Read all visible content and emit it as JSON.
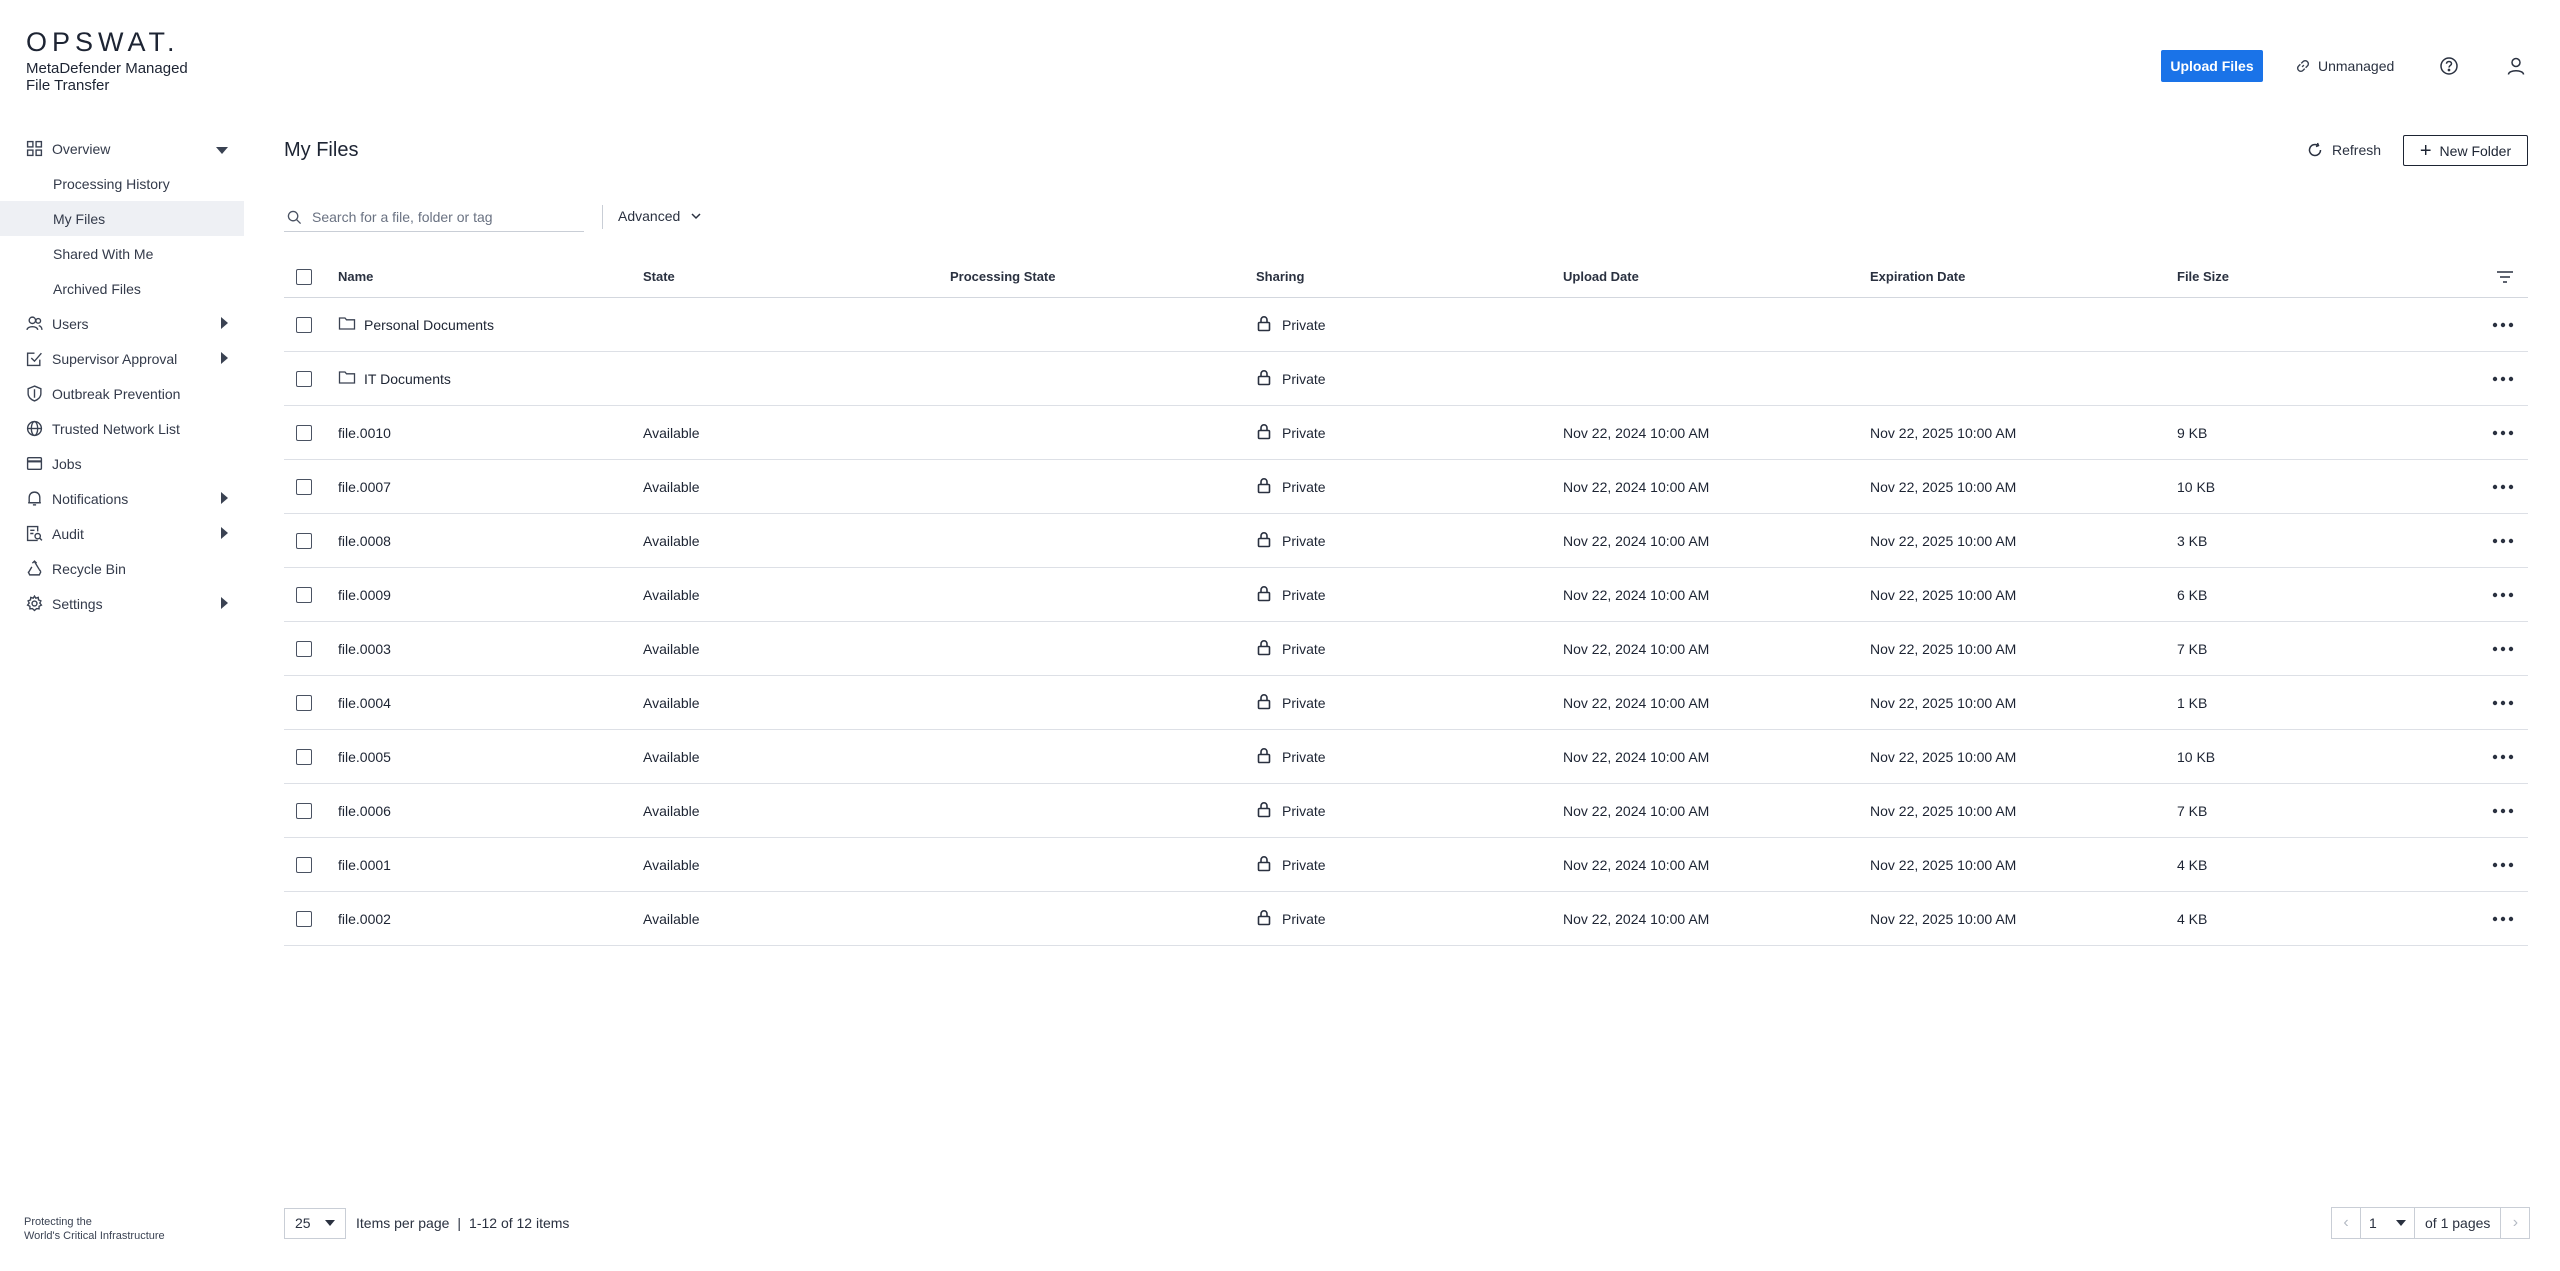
{
  "brand": {
    "logo": "OPSWAT.",
    "product": "MetaDefender Managed File Transfer",
    "footer_line1": "Protecting the",
    "footer_line2": "World's Critical Infrastructure"
  },
  "header": {
    "upload_label": "Upload Files",
    "unmanaged_label": "Unmanaged",
    "accent_color": "#1a73e8"
  },
  "sidebar": {
    "items": [
      {
        "label": "Overview",
        "icon": "grid-icon",
        "expanded": true
      },
      {
        "label": "Processing History"
      },
      {
        "label": "My Files",
        "active": true
      },
      {
        "label": "Shared With Me"
      },
      {
        "label": "Archived Files"
      },
      {
        "label": "Users",
        "icon": "users-icon"
      },
      {
        "label": "Supervisor Approval",
        "icon": "approval-icon"
      },
      {
        "label": "Outbreak Prevention",
        "icon": "shield-icon"
      },
      {
        "label": "Trusted Network List",
        "icon": "globe-icon"
      },
      {
        "label": "Jobs",
        "icon": "jobs-icon"
      },
      {
        "label": "Notifications",
        "icon": "bell-icon"
      },
      {
        "label": "Audit",
        "icon": "audit-icon"
      },
      {
        "label": "Recycle Bin",
        "icon": "recycle-icon"
      },
      {
        "label": "Settings",
        "icon": "gear-icon"
      }
    ]
  },
  "main": {
    "title": "My Files",
    "refresh_label": "Refresh",
    "new_folder_label": "New Folder",
    "search_placeholder": "Search for a file, folder or tag",
    "advanced_label": "Advanced"
  },
  "table": {
    "columns": [
      "Name",
      "State",
      "Processing State",
      "Sharing",
      "Upload Date",
      "Expiration Date",
      "File Size"
    ],
    "rows": [
      {
        "name": "Personal Documents",
        "type": "folder",
        "state": "",
        "processing": "",
        "sharing": "Private",
        "upload": "",
        "expiration": "",
        "size": ""
      },
      {
        "name": "IT Documents",
        "type": "folder",
        "state": "",
        "processing": "",
        "sharing": "Private",
        "upload": "",
        "expiration": "",
        "size": ""
      },
      {
        "name": "file.0010",
        "type": "file",
        "state": "Available",
        "processing": "",
        "sharing": "Private",
        "upload": "Nov 22, 2024 10:00 AM",
        "expiration": "Nov 22, 2025 10:00 AM",
        "size": "9 KB"
      },
      {
        "name": "file.0007",
        "type": "file",
        "state": "Available",
        "processing": "",
        "sharing": "Private",
        "upload": "Nov 22, 2024 10:00 AM",
        "expiration": "Nov 22, 2025 10:00 AM",
        "size": "10 KB"
      },
      {
        "name": "file.0008",
        "type": "file",
        "state": "Available",
        "processing": "",
        "sharing": "Private",
        "upload": "Nov 22, 2024 10:00 AM",
        "expiration": "Nov 22, 2025 10:00 AM",
        "size": "3 KB"
      },
      {
        "name": "file.0009",
        "type": "file",
        "state": "Available",
        "processing": "",
        "sharing": "Private",
        "upload": "Nov 22, 2024 10:00 AM",
        "expiration": "Nov 22, 2025 10:00 AM",
        "size": "6 KB"
      },
      {
        "name": "file.0003",
        "type": "file",
        "state": "Available",
        "processing": "",
        "sharing": "Private",
        "upload": "Nov 22, 2024 10:00 AM",
        "expiration": "Nov 22, 2025 10:00 AM",
        "size": "7 KB"
      },
      {
        "name": "file.0004",
        "type": "file",
        "state": "Available",
        "processing": "",
        "sharing": "Private",
        "upload": "Nov 22, 2024 10:00 AM",
        "expiration": "Nov 22, 2025 10:00 AM",
        "size": "1 KB"
      },
      {
        "name": "file.0005",
        "type": "file",
        "state": "Available",
        "processing": "",
        "sharing": "Private",
        "upload": "Nov 22, 2024 10:00 AM",
        "expiration": "Nov 22, 2025 10:00 AM",
        "size": "10 KB"
      },
      {
        "name": "file.0006",
        "type": "file",
        "state": "Available",
        "processing": "",
        "sharing": "Private",
        "upload": "Nov 22, 2024 10:00 AM",
        "expiration": "Nov 22, 2025 10:00 AM",
        "size": "7 KB"
      },
      {
        "name": "file.0001",
        "type": "file",
        "state": "Available",
        "processing": "",
        "sharing": "Private",
        "upload": "Nov 22, 2024 10:00 AM",
        "expiration": "Nov 22, 2025 10:00 AM",
        "size": "4 KB"
      },
      {
        "name": "file.0002",
        "type": "file",
        "state": "Available",
        "processing": "",
        "sharing": "Private",
        "upload": "Nov 22, 2024 10:00 AM",
        "expiration": "Nov 22, 2025 10:00 AM",
        "size": "4 KB"
      }
    ]
  },
  "pagination": {
    "per_page": "25",
    "per_page_label": "Items per page",
    "range_label": "1-12 of 12 items",
    "page": "1",
    "of_pages": "of 1 pages"
  }
}
